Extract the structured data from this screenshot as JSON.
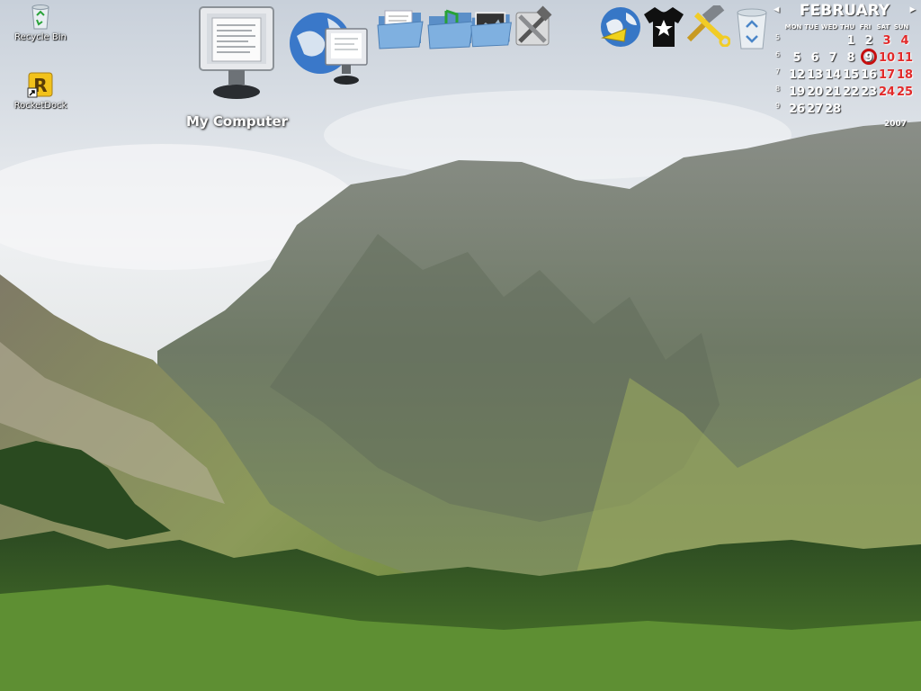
{
  "desktop": {
    "icons": [
      {
        "label": "Recycle Bin"
      },
      {
        "label": "RocketDock"
      }
    ]
  },
  "dock": {
    "hover_label": "My Computer",
    "items": [
      {
        "icon": "my-computer-icon"
      },
      {
        "icon": "network-globe-icon"
      },
      {
        "icon": "documents-folder-icon"
      },
      {
        "icon": "music-folder-icon"
      },
      {
        "icon": "pictures-folder-icon"
      },
      {
        "icon": "tools-icon"
      },
      {
        "icon": "internet-globe-icon"
      },
      {
        "icon": "tshirt-icon"
      },
      {
        "icon": "hammer-wrench-icon"
      },
      {
        "icon": "recycle-bin-icon"
      }
    ]
  },
  "calendar": {
    "month": "FEBRUARY",
    "year": "2007",
    "prev_arrow": "◂",
    "next_arrow": "▸",
    "weekdays": [
      "MON",
      "TUE",
      "WED",
      "THU",
      "FRI",
      "SAT",
      "SUN"
    ],
    "weeks": [
      {
        "week": "5",
        "days": [
          "",
          "",
          "",
          "1",
          "2",
          "3",
          "4"
        ]
      },
      {
        "week": "6",
        "days": [
          "5",
          "6",
          "7",
          "8",
          "9",
          "10",
          "11"
        ]
      },
      {
        "week": "7",
        "days": [
          "12",
          "13",
          "14",
          "15",
          "16",
          "17",
          "18"
        ]
      },
      {
        "week": "8",
        "days": [
          "19",
          "20",
          "21",
          "22",
          "23",
          "24",
          "25"
        ]
      },
      {
        "week": "9",
        "days": [
          "26",
          "27",
          "28",
          "",
          "",
          "",
          ""
        ]
      }
    ],
    "today": "9",
    "accent_color": "#c60f0f"
  }
}
